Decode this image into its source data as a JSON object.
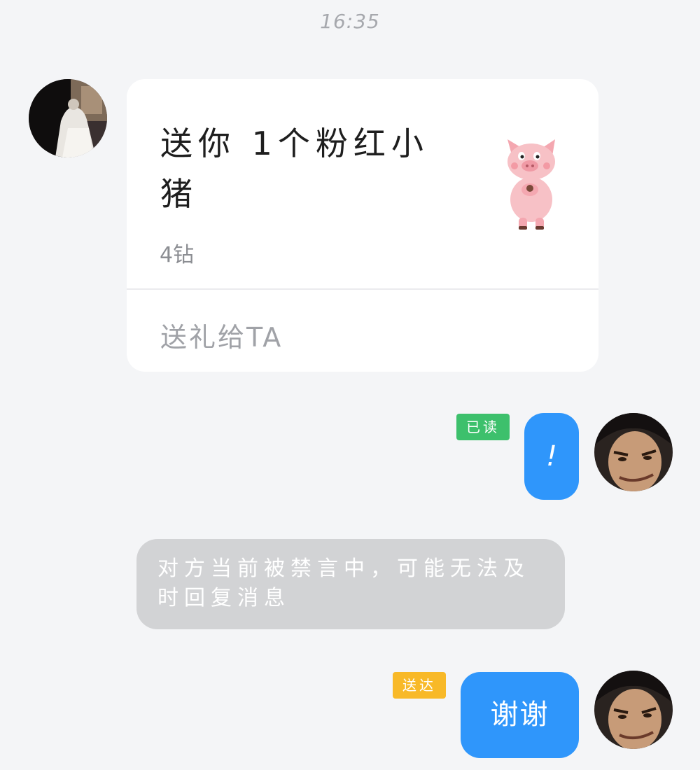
{
  "chat": {
    "timestamp": "16:35",
    "gift_card": {
      "title": "送你 1个粉红小猪",
      "price": "4钻",
      "action": "送礼给TA",
      "icon": "pink-pig-sticker"
    },
    "messages": [
      {
        "text": "!",
        "status": "已读",
        "status_color": "#3dc06c"
      },
      {
        "text": "谢谢",
        "status": "送达",
        "status_color": "#f8b928"
      }
    ],
    "system_notice": "对方当前被禁言中，可能无法及时回复消息",
    "colors": {
      "background": "#f4f5f7",
      "outgoing_bubble": "#2f96fb",
      "notice_bubble": "#d2d3d5"
    }
  }
}
